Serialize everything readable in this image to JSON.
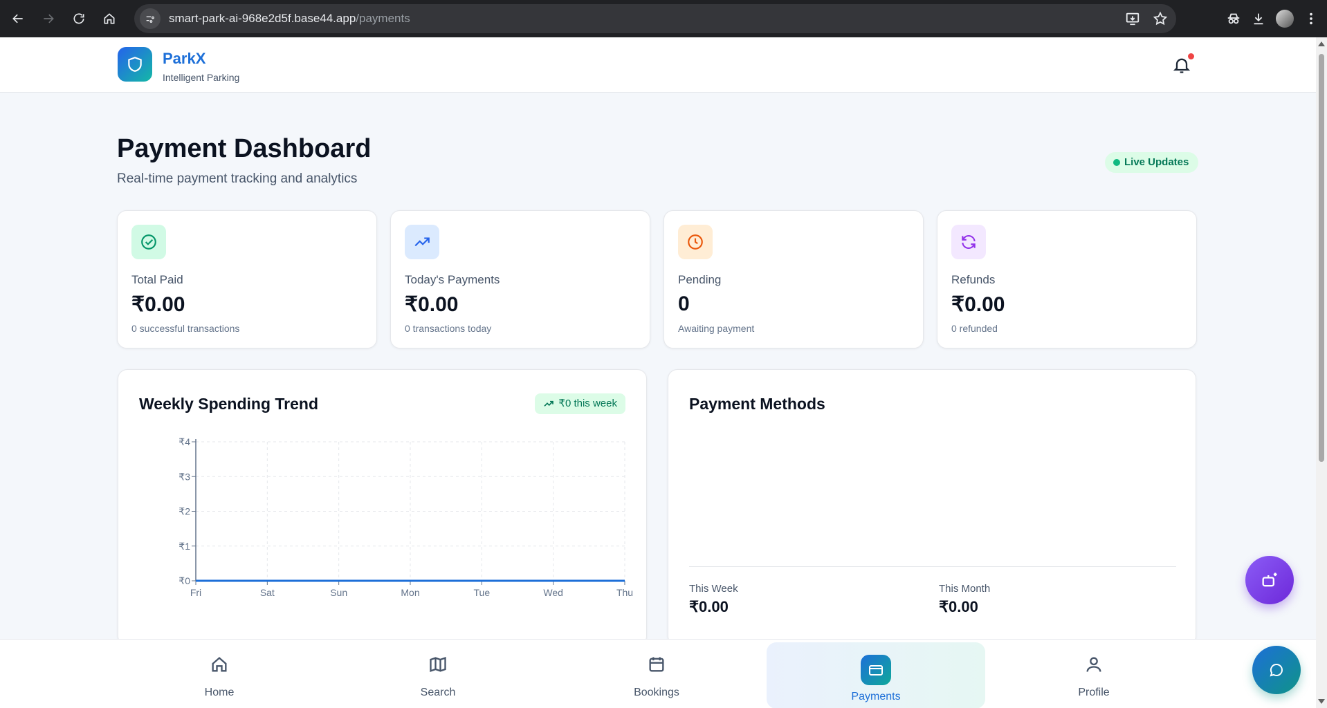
{
  "browser": {
    "url_host": "smart-park-ai-968e2d5f.base44.app",
    "url_path": "/payments"
  },
  "header": {
    "brand": "ParkX",
    "tagline": "Intelligent Parking"
  },
  "page": {
    "title": "Payment Dashboard",
    "subtitle": "Real-time payment tracking and analytics",
    "live_badge": "Live Updates"
  },
  "stats": [
    {
      "label": "Total Paid",
      "value": "₹0.00",
      "note": "0 successful transactions",
      "icon": "check-circle-icon",
      "color": "#059669",
      "bg": "#d1fae5"
    },
    {
      "label": "Today's Payments",
      "value": "₹0.00",
      "note": "0 transactions today",
      "icon": "trending-up-icon",
      "color": "#2563eb",
      "bg": "#dbeafe"
    },
    {
      "label": "Pending",
      "value": "0",
      "note": "Awaiting payment",
      "icon": "clock-icon",
      "color": "#ea580c",
      "bg": "#ffedd5"
    },
    {
      "label": "Refunds",
      "value": "₹0.00",
      "note": "0 refunded",
      "icon": "refresh-icon",
      "color": "#9333ea",
      "bg": "#f3e8ff"
    }
  ],
  "weekly": {
    "title": "Weekly Spending Trend",
    "badge": "₹0 this week"
  },
  "chart_data": {
    "type": "line",
    "categories": [
      "Fri",
      "Sat",
      "Sun",
      "Mon",
      "Tue",
      "Wed",
      "Thu"
    ],
    "values": [
      0,
      0,
      0,
      0,
      0,
      0,
      0
    ],
    "y_ticks": [
      "₹0",
      "₹1",
      "₹2",
      "₹3",
      "₹4"
    ],
    "ylim": [
      0,
      4
    ],
    "grid": true,
    "line_color": "#1d6fd8"
  },
  "methods": {
    "title": "Payment Methods",
    "this_week_label": "This Week",
    "this_week_value": "₹0.00",
    "this_month_label": "This Month",
    "this_month_value": "₹0.00"
  },
  "nav": [
    {
      "label": "Home",
      "icon": "home-icon"
    },
    {
      "label": "Search",
      "icon": "map-icon"
    },
    {
      "label": "Bookings",
      "icon": "calendar-icon"
    },
    {
      "label": "Payments",
      "icon": "credit-card-icon"
    },
    {
      "label": "Profile",
      "icon": "user-icon"
    }
  ]
}
